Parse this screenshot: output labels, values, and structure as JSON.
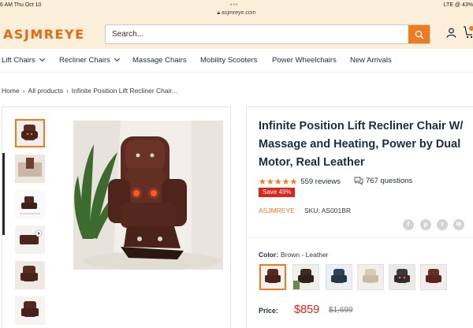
{
  "status_bar": {
    "time": "6 AM   Thu Oct 10",
    "url": "asjmreye.com",
    "signal": "LTE @ 43%"
  },
  "header": {
    "logo": "ASJMREYE",
    "search_placeholder": "Search...",
    "icons": [
      "search-icon",
      "user-icon",
      "cart-icon"
    ],
    "accent_color": "#ee7b1e"
  },
  "nav": {
    "items": [
      {
        "label": "Lift Chairs",
        "has_dropdown": true
      },
      {
        "label": "Recliner Chairs",
        "has_dropdown": true
      },
      {
        "label": "Massage Chairs",
        "has_dropdown": false
      },
      {
        "label": "Mobility Scooters",
        "has_dropdown": false
      },
      {
        "label": "Power Wheelchairs",
        "has_dropdown": false
      },
      {
        "label": "New Arrivals",
        "has_dropdown": false
      }
    ]
  },
  "breadcrumb": {
    "items": [
      "Home",
      "All products",
      "Infinite Position Lift Recliner Chair..."
    ]
  },
  "product": {
    "title": "Infinite Position Lift Recliner Chair W/ Massage and Heating, Power by Dual Motor, Real Leather",
    "stars": "★★★★★",
    "rating": 5,
    "reviews": "559 reviews",
    "questions": "767 questions",
    "sale_badge": "Save 49%",
    "vendor": "ASJMREYE",
    "sku": "SKU: AS001BR",
    "social_icons": [
      "facebook-icon",
      "pinterest-icon",
      "twitter-icon",
      "email-icon"
    ],
    "color_label": "Color:",
    "color_value": "Brown - Leather",
    "swatch_count": 6,
    "price_label": "Price:",
    "price": "$859",
    "compare_price": "$1,699",
    "sale_color": "#e0211b"
  }
}
